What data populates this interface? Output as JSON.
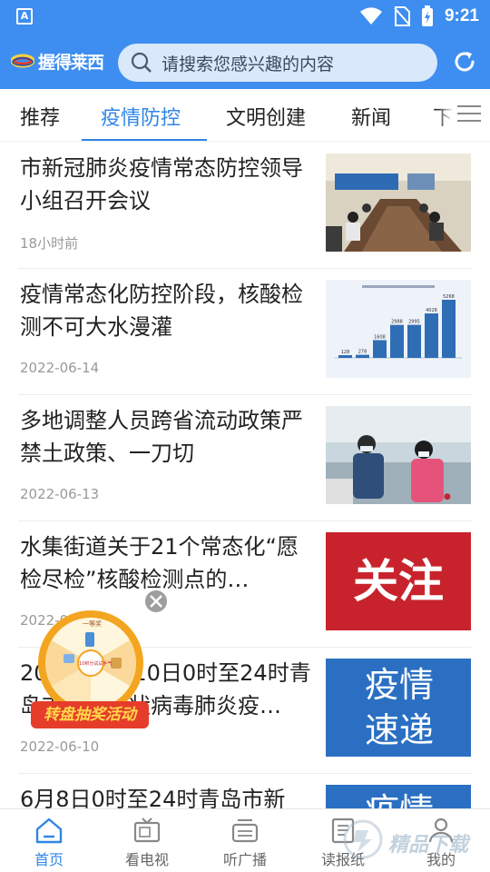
{
  "status_bar": {
    "time": "9:21",
    "notification_letter": "A"
  },
  "header": {
    "logo_text": "握得莱西",
    "search_placeholder": "请搜索您感兴趣的内容"
  },
  "tabs": [
    {
      "label": "推荐",
      "active": false
    },
    {
      "label": "疫情防控",
      "active": true
    },
    {
      "label": "文明创建",
      "active": false
    },
    {
      "label": "新闻",
      "active": false
    },
    {
      "label": "下",
      "active": false
    }
  ],
  "news": [
    {
      "title": "市新冠肺炎疫情常态防控领导小组召开会议",
      "time": "18小时前",
      "thumb": "meeting-photo"
    },
    {
      "title": "疫情常态化防控阶段，核酸检测不可大水漫灌",
      "time": "2022-06-14",
      "thumb": "bar-chart-image"
    },
    {
      "title": "多地调整人员跨省流动政策严禁土政策、一刀切",
      "time": "2022-06-13",
      "thumb": "station-photo"
    },
    {
      "title": "水集街道关于21个常态化“愿检尽检”核酸检测点的…",
      "time": "2022-06-11",
      "thumb_text": "关注"
    },
    {
      "title": "2022年6月10日0时至24时青岛市新型冠状病毒肺炎疫…",
      "time": "2022-06-10",
      "thumb_text": "疫情速递"
    },
    {
      "title": "6月8日0时至24时青岛市新",
      "time": "",
      "thumb_text": "疫情"
    }
  ],
  "thumb_chart": {
    "bar_labels": [
      "128",
      "278",
      "1608",
      "2988",
      "2995",
      "4028",
      "5268"
    ]
  },
  "wheel": {
    "banner": "转盘抽奖活动",
    "prize_top": "一等奖",
    "center": "10积分试试手气"
  },
  "bottom_nav": [
    {
      "label": "首页",
      "icon": "home-icon",
      "active": true
    },
    {
      "label": "看电视",
      "icon": "tv-icon",
      "active": false
    },
    {
      "label": "听广播",
      "icon": "radio-icon",
      "active": false
    },
    {
      "label": "读报纸",
      "icon": "newspaper-icon",
      "active": false
    },
    {
      "label": "我的",
      "icon": "user-icon",
      "active": false
    }
  ],
  "watermark": {
    "text": "精品下载"
  },
  "colors": {
    "brand_blue": "#3d8ef0",
    "active_blue": "#2f86e6",
    "red": "#c8232c",
    "tile_blue": "#2a6fc2"
  }
}
